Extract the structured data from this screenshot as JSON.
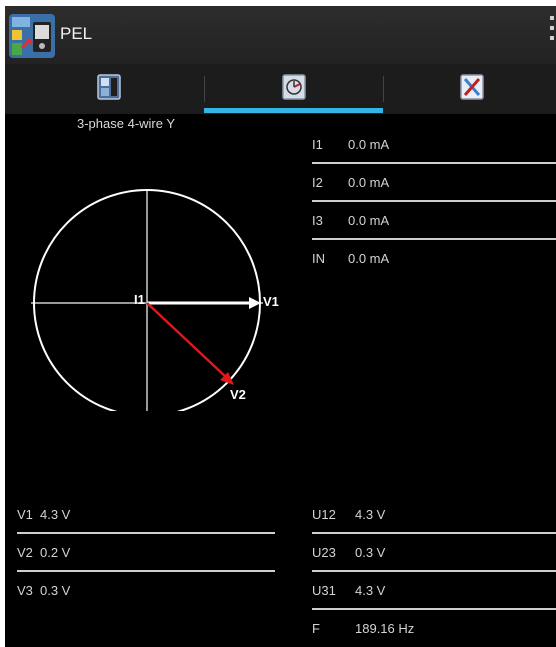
{
  "app": {
    "title": "PEL",
    "icon": "pel-app-icon"
  },
  "tabs": [
    {
      "icon": "device-info-icon",
      "active": false
    },
    {
      "icon": "phasor-diagram-icon",
      "active": true
    },
    {
      "icon": "settings-tools-icon",
      "active": false
    }
  ],
  "config": "3-phase 4-wire Y",
  "phasor": {
    "labels": {
      "i1": "I1",
      "v1": "V1",
      "v2": "V2"
    },
    "colors": {
      "circle": "#ffffff",
      "v1": "#ffffff",
      "v2": "#e01818"
    }
  },
  "currents": [
    {
      "name": "I1",
      "value": "0.0 mA"
    },
    {
      "name": "I2",
      "value": "0.0 mA"
    },
    {
      "name": "I3",
      "value": "0.0 mA"
    },
    {
      "name": "IN",
      "value": "0.0 mA"
    }
  ],
  "voltages": [
    {
      "name": "V1",
      "value": "4.3 V"
    },
    {
      "name": "V2",
      "value": "0.2 V"
    },
    {
      "name": "V3",
      "value": "0.3 V"
    }
  ],
  "line_voltages": [
    {
      "name": "U12",
      "value": "4.3 V"
    },
    {
      "name": "U23",
      "value": "0.3 V"
    },
    {
      "name": "U31",
      "value": "4.3 V"
    },
    {
      "name": "F",
      "value": "189.16 Hz"
    }
  ],
  "theme": {
    "accent": "#33b5e5",
    "background": "#000000",
    "text": "#d4d4d4"
  }
}
